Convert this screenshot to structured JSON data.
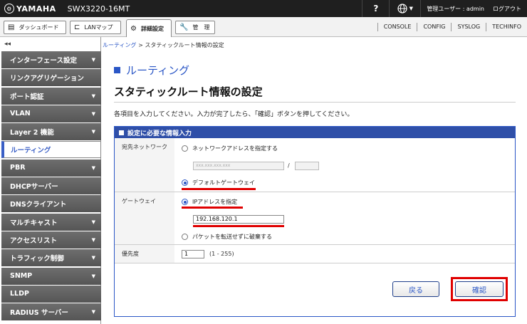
{
  "header": {
    "brand": "YAMAHA",
    "model": "SWX3220-16MT",
    "help": "?",
    "lang_icon": "globe-icon",
    "user": "管理ユーザー : admin",
    "logout": "ログアウト"
  },
  "nav": {
    "tabs": [
      {
        "label": "ダッシュボード",
        "icon": "dashboard-icon"
      },
      {
        "label": "LANマップ",
        "icon": "lan-map-icon"
      },
      {
        "label": "詳細設定",
        "icon": "gear-icon"
      },
      {
        "label": "管　理",
        "icon": "wrench-icon"
      }
    ],
    "links": [
      "CONSOLE",
      "CONFIG",
      "SYSLOG",
      "TECHINFO"
    ]
  },
  "sidebar": {
    "collapse": "◂◂",
    "items": [
      {
        "label": "インターフェース設定",
        "arrow": "▼"
      },
      {
        "label": "リンクアグリゲーション",
        "arrow": ""
      },
      {
        "label": "ポート認証",
        "arrow": "▼"
      },
      {
        "label": "VLAN",
        "arrow": "▼"
      },
      {
        "label": "Layer 2 機能",
        "arrow": "▼"
      },
      {
        "label": "ルーティング",
        "arrow": ""
      },
      {
        "label": "PBR",
        "arrow": "▼"
      },
      {
        "label": "DHCPサーバー",
        "arrow": ""
      },
      {
        "label": "DNSクライアント",
        "arrow": ""
      },
      {
        "label": "マルチキャスト",
        "arrow": "▼"
      },
      {
        "label": "アクセスリスト",
        "arrow": "▼"
      },
      {
        "label": "トラフィック制御",
        "arrow": "▼"
      },
      {
        "label": "SNMP",
        "arrow": "▼"
      },
      {
        "label": "LLDP",
        "arrow": ""
      },
      {
        "label": "RADIUS サーバー",
        "arrow": "▼"
      }
    ]
  },
  "breadcrumb": {
    "link": "ルーティング",
    "sep": " > ",
    "current": "スタティックルート情報の設定"
  },
  "main": {
    "section": "ルーティング",
    "title": "スタティックルート情報の設定",
    "instruction": "各項目を入力してください。入力が完了したら、「確認」ボタンを押してください。",
    "panel_title": "設定に必要な情報入力",
    "destination": {
      "label": "宛先ネットワーク",
      "option_network": "ネットワークアドレスを指定する",
      "address_placeholder": "xxx.xxx.xxx.xxx",
      "slash": "/",
      "option_default": "デフォルトゲートウェイ"
    },
    "gateway": {
      "label": "ゲートウェイ",
      "option_ip": "IPアドレスを指定",
      "ip_value": "192.168.120.1",
      "option_discard": "パケットを転送せずに破棄する"
    },
    "priority": {
      "label": "優先度",
      "value": "1",
      "range": "(1 - 255)"
    },
    "back_button": "戻る",
    "confirm_button": "確認"
  },
  "colors": {
    "accent": "#2a56c6",
    "highlight": "#e00000",
    "topbar": "#1f1f1f"
  }
}
